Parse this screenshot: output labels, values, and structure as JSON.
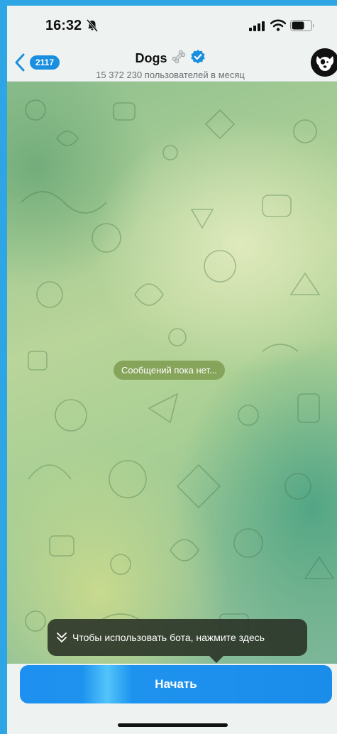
{
  "status_bar": {
    "time": "16:32"
  },
  "header": {
    "back_count": "2117",
    "title": "Dogs",
    "subtitle": "15 372 230 пользователей в месяц"
  },
  "chat": {
    "empty_text": "Сообщений пока нет...",
    "hint_text": "Чтобы использовать бота, нажмите здесь"
  },
  "footer": {
    "start_label": "Начать"
  },
  "colors": {
    "accent": "#1a8fe0",
    "frame": "#2ea6e6",
    "verified": "#1a8fe0"
  },
  "icons": [
    "mute-icon",
    "signal-icon",
    "wifi-icon",
    "battery-icon",
    "chevron-left-icon",
    "bone-icon",
    "verified-icon",
    "dog-avatar-icon",
    "double-chevron-down-icon"
  ]
}
